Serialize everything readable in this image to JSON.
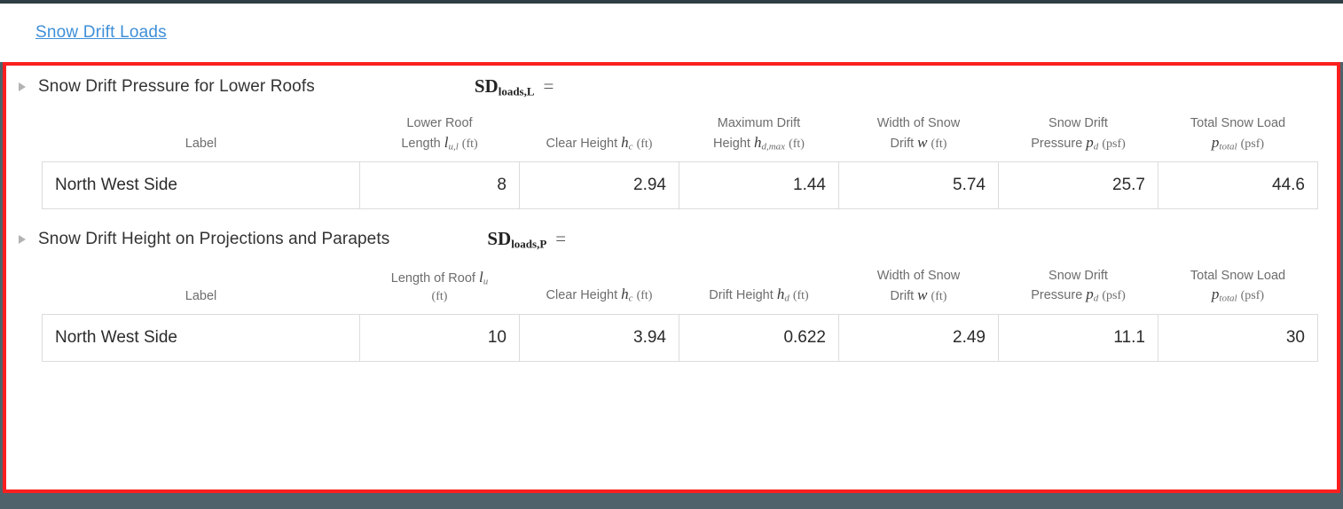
{
  "window": {
    "breadcrumb": "Snow Drift Loads",
    "link_color": "#3f8fd8",
    "highlight_border_color": "#fb1f1f",
    "page_background": "#ffffff",
    "outer_background": "#4e626c"
  },
  "sections": [
    {
      "title": "Snow Drift Pressure for Lower Roofs",
      "expression": {
        "base": "SD",
        "subscript": "loads,L",
        "operator": "="
      },
      "disclosure_icon": "triangle-right-icon",
      "table": {
        "headers": [
          {
            "line1": "",
            "line2": "Label",
            "symbol": "",
            "sub": "",
            "unit": ""
          },
          {
            "line1": "Lower Roof",
            "line2": "Length",
            "symbol": "l",
            "sub": "u,l",
            "unit": "(ft)"
          },
          {
            "line1": "",
            "line2": "Clear Height",
            "symbol": "h",
            "sub": "c",
            "unit": "(ft)"
          },
          {
            "line1": "Maximum Drift",
            "line2": "Height",
            "symbol": "h",
            "sub": "d,max",
            "unit": "(ft)"
          },
          {
            "line1": "Width of Snow",
            "line2": "Drift",
            "symbol": "w",
            "sub": "",
            "unit": "(ft)"
          },
          {
            "line1": "Snow Drift",
            "line2": "Pressure",
            "symbol": "p",
            "sub": "d",
            "unit": "(psf)"
          },
          {
            "line1": "Total Snow Load",
            "line2": "",
            "symbol": "p",
            "sub": "total",
            "unit": "(psf)"
          }
        ],
        "rows": [
          {
            "label": "North West Side",
            "values": [
              "8",
              "2.94",
              "1.44",
              "5.74",
              "25.7",
              "44.6"
            ]
          }
        ]
      }
    },
    {
      "title": "Snow Drift Height on Projections and Parapets",
      "expression": {
        "base": "SD",
        "subscript": "loads,P",
        "operator": "="
      },
      "disclosure_icon": "triangle-right-icon",
      "table": {
        "headers": [
          {
            "line1": "",
            "line2": "Label",
            "symbol": "",
            "sub": "",
            "unit": ""
          },
          {
            "line1": "Length of Roof",
            "line2": "",
            "symbol": "l",
            "sub": "u",
            "unit": "(ft)"
          },
          {
            "line1": "",
            "line2": "Clear Height",
            "symbol": "h",
            "sub": "c",
            "unit": "(ft)"
          },
          {
            "line1": "",
            "line2": "Drift Height",
            "symbol": "h",
            "sub": "d",
            "unit": "(ft)"
          },
          {
            "line1": "Width of Snow",
            "line2": "Drift",
            "symbol": "w",
            "sub": "",
            "unit": "(ft)"
          },
          {
            "line1": "Snow Drift",
            "line2": "Pressure",
            "symbol": "p",
            "sub": "d",
            "unit": "(psf)"
          },
          {
            "line1": "Total Snow Load",
            "line2": "",
            "symbol": "p",
            "sub": "total",
            "unit": "(psf)"
          }
        ],
        "rows": [
          {
            "label": "North West Side",
            "values": [
              "10",
              "3.94",
              "0.622",
              "2.49",
              "11.1",
              "30"
            ]
          }
        ]
      }
    }
  ]
}
